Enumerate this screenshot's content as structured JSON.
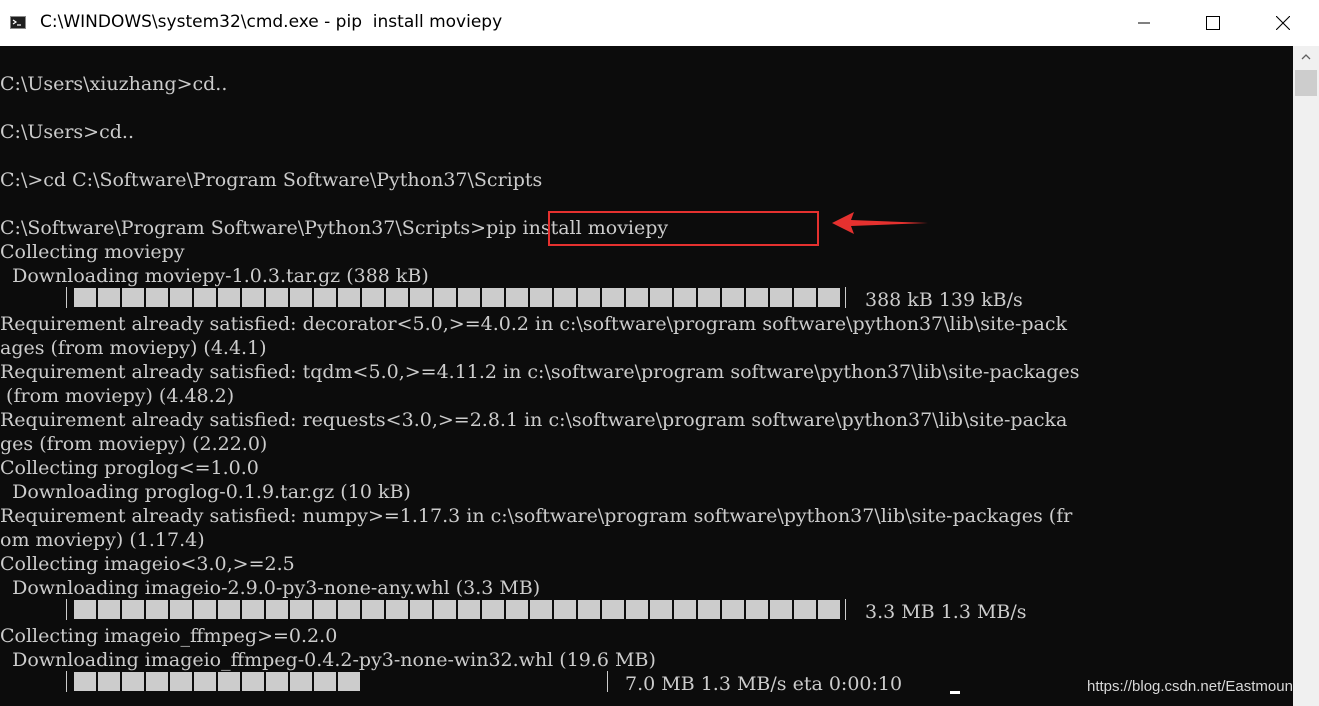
{
  "window": {
    "title": "C:\\WINDOWS\\system32\\cmd.exe - pip  install moviepy",
    "icon": "cmd-icon",
    "controls": [
      "minimize-icon",
      "maximize-icon",
      "close-icon"
    ]
  },
  "console": {
    "lines": [
      "C:\\Users\\xiuzhang>cd..",
      "",
      "C:\\Users>cd..",
      "",
      "C:\\>cd C:\\Software\\Program Software\\Python37\\Scripts",
      "",
      "C:\\Software\\Program Software\\Python37\\Scripts>pip install moviepy",
      "Collecting moviepy",
      "  Downloading moviepy-1.0.3.tar.gz (388 kB)",
      "",
      "Requirement already satisfied: decorator<5.0,>=4.0.2 in c:\\software\\program software\\python37\\lib\\site-pack",
      "ages (from moviepy) (4.4.1)",
      "Requirement already satisfied: tqdm<5.0,>=4.11.2 in c:\\software\\program software\\python37\\lib\\site-packages",
      " (from moviepy) (4.48.2)",
      "Requirement already satisfied: requests<3.0,>=2.8.1 in c:\\software\\program software\\python37\\lib\\site-packa",
      "ges (from moviepy) (2.22.0)",
      "Collecting proglog<=1.0.0",
      "  Downloading proglog-0.1.9.tar.gz (10 kB)",
      "Requirement already satisfied: numpy>=1.17.3 in c:\\software\\program software\\python37\\lib\\site-packages (fr",
      "om moviepy) (1.17.4)",
      "Collecting imageio<3.0,>=2.5",
      "  Downloading imageio-2.9.0-py3-none-any.whl (3.3 MB)",
      "",
      "Collecting imageio_ffmpeg>=0.2.0",
      "  Downloading imageio_ffmpeg-0.4.2-py3-none-win32.whl (19.6 MB)",
      ""
    ],
    "progress": [
      {
        "fraction": 1.0,
        "status": "388 kB 139 kB/s"
      },
      {
        "fraction": 1.0,
        "status": "3.3 MB 1.3 MB/s"
      },
      {
        "fraction": 0.36,
        "status": "7.0 MB 1.3 MB/s eta 0:00:10"
      }
    ]
  },
  "annotation": {
    "highlighted_command": "pip install moviepy",
    "box_color": "#e5312f",
    "arrow_color": "#e5312f"
  },
  "watermark": "https://blog.csdn.net/Eastmount",
  "colors": {
    "console_bg": "#0c0c0c",
    "console_text": "#cccccc",
    "titlebar_bg": "#ffffff"
  }
}
